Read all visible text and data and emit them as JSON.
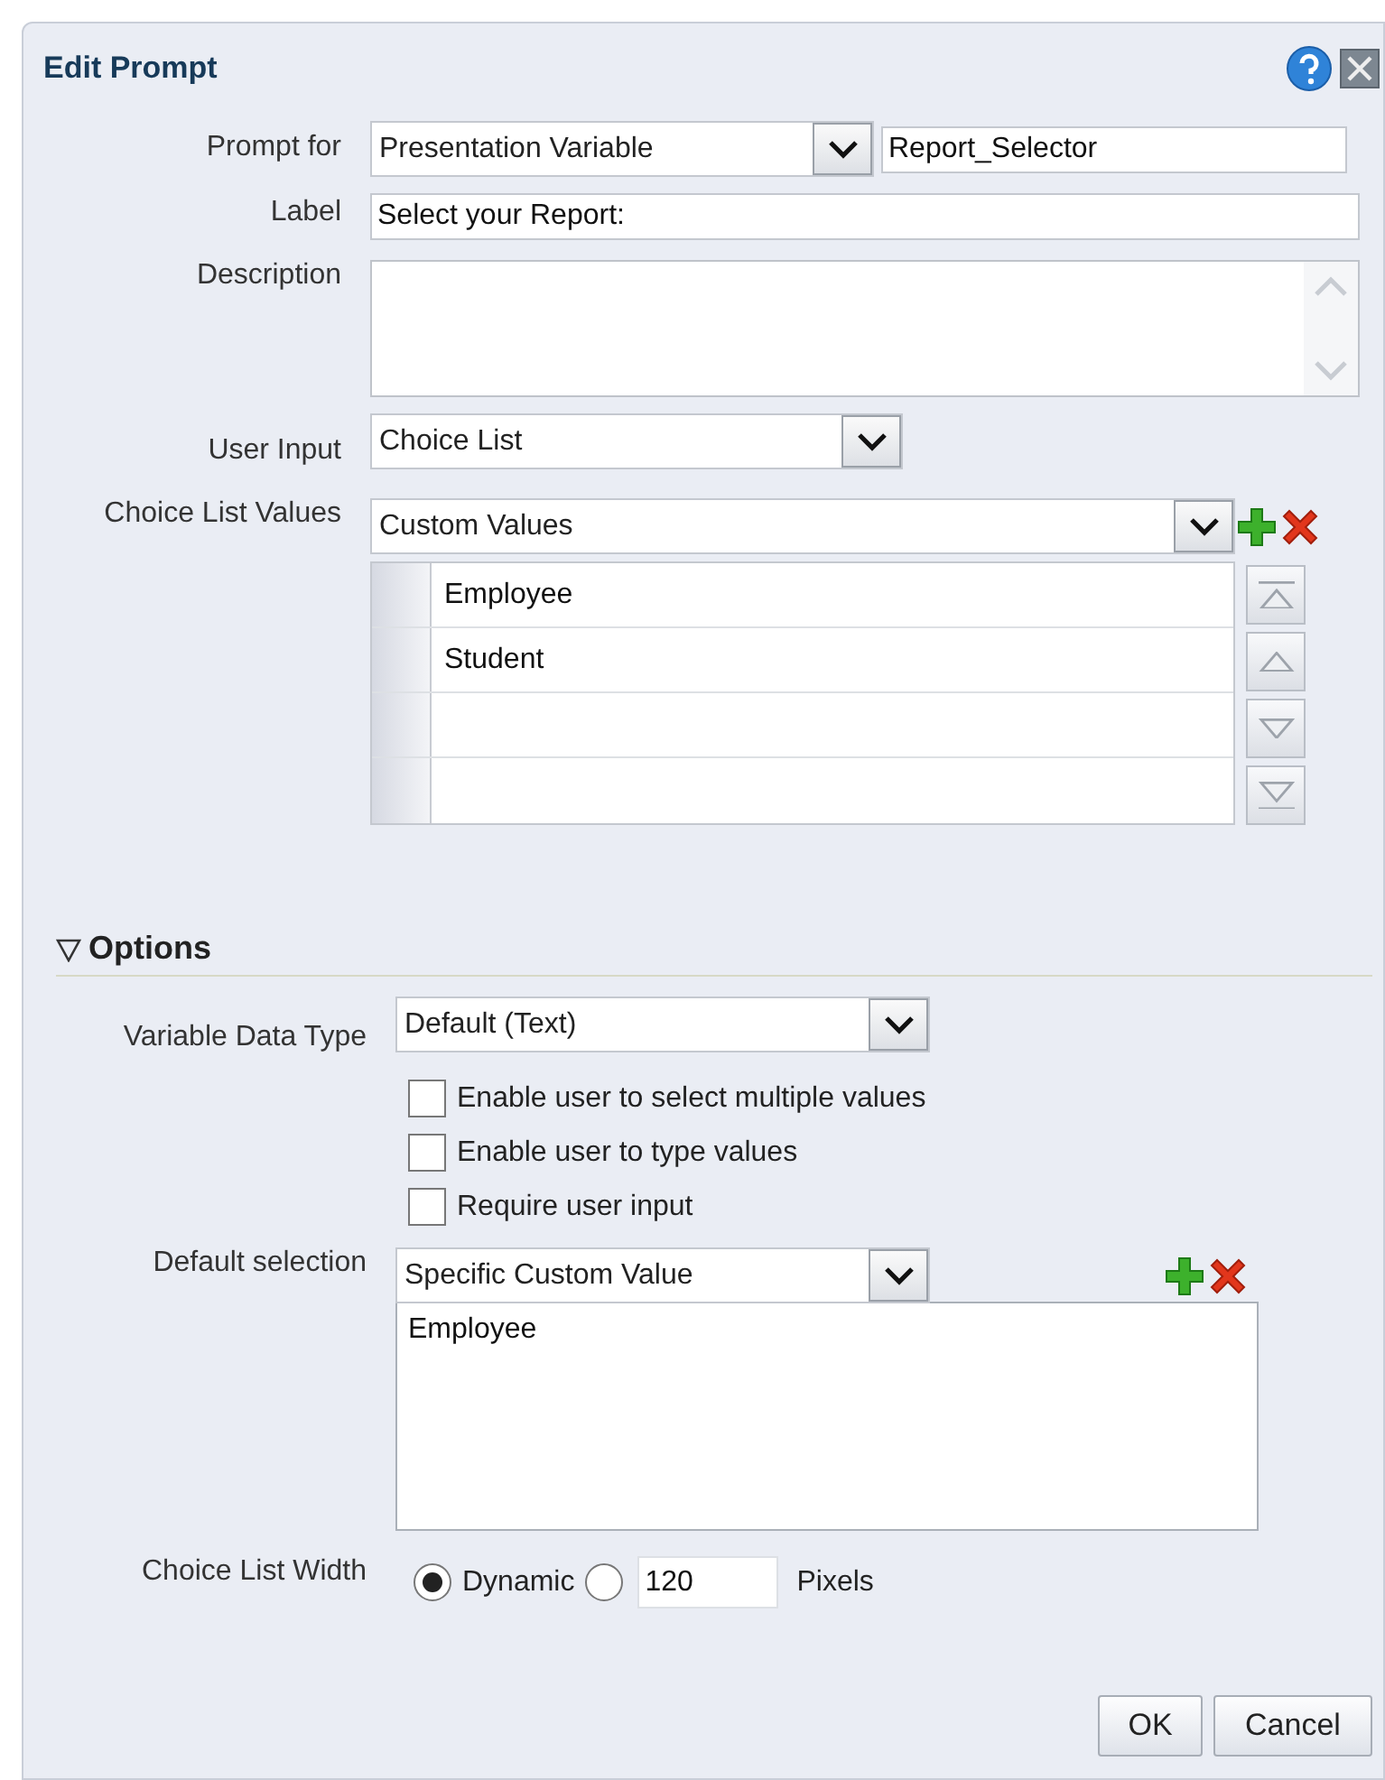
{
  "dialog": {
    "title": "Edit Prompt"
  },
  "prompt_for": {
    "label": "Prompt for",
    "type_value": "Presentation Variable",
    "name_value": "Report_Selector"
  },
  "label_field": {
    "label": "Label",
    "value": "Select your Report:"
  },
  "description": {
    "label": "Description"
  },
  "user_input": {
    "label": "User Input",
    "value": "Choice List"
  },
  "choice_list_values": {
    "label": "Choice List Values",
    "value": "Custom Values",
    "rows": [
      {
        "value": "Employee"
      },
      {
        "value": "Student"
      },
      {},
      {}
    ]
  },
  "options": {
    "title": "Options",
    "expanded": true,
    "variable_data_type": {
      "label": "Variable Data Type",
      "value": "Default (Text)"
    },
    "checkboxes": [
      {
        "label": "Enable user to select multiple values",
        "checked": false
      },
      {
        "label": "Enable user to type values",
        "checked": false
      },
      {
        "label": "Require user input",
        "checked": false
      }
    ],
    "default_selection": {
      "label": "Default selection",
      "value": "Specific Custom Value",
      "values": [
        "Employee"
      ]
    },
    "choice_list_width": {
      "label": "Choice List Width",
      "radios": [
        {
          "label": "Dynamic",
          "selected": true
        },
        {
          "selected": false
        }
      ],
      "pixels_value": "120",
      "unit": "Pixels"
    }
  },
  "buttons": [
    "OK",
    "Cancel"
  ]
}
